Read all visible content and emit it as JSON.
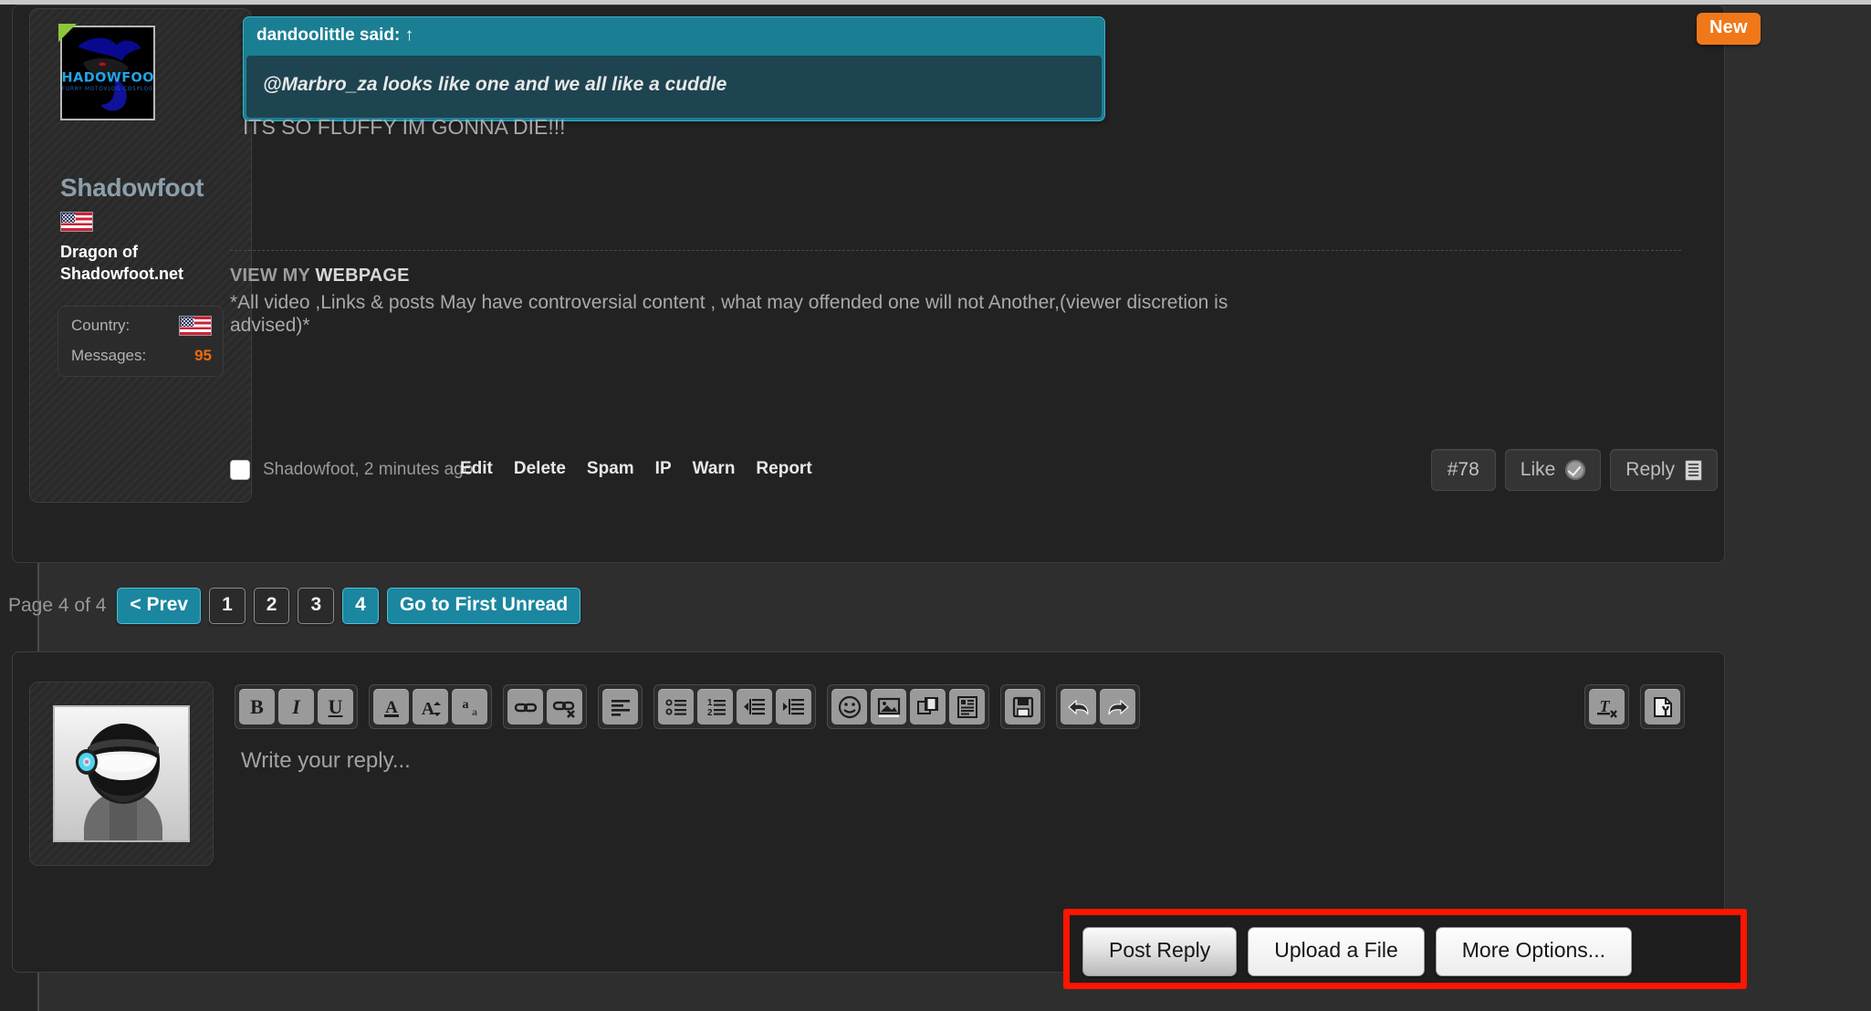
{
  "post": {
    "new_badge": "New",
    "member": {
      "name": "Shadowfoot",
      "title": "Dragon of Shadowfoot.net",
      "avatar_text": "SHADOWFOOT",
      "avatar_subtext": "FURRY MOTOVLOG COSPLOG",
      "stats": [
        {
          "label": "Country:",
          "value": "",
          "type": "flag"
        },
        {
          "label": "Messages:",
          "value": "95",
          "type": "number"
        }
      ],
      "country_flag": "us-flag-icon"
    },
    "quote": {
      "author_line": "dandoolittle said:",
      "jump_arrow": "↑",
      "text": "@Marbro_za looks like one and we all like a cuddle"
    },
    "body_text": "ITS SO FLUFFY IM GONNA DIE!!!",
    "signature": {
      "line1_prefix": "VIEW MY ",
      "line1_bold": "WEBPAGE",
      "line2": "*All video ,Links & posts May have controversial content , what may offended one will not Another,(viewer discretion is advised)*"
    },
    "footer": {
      "meta": "Shadowfoot, 2 minutes ago",
      "links": [
        "Edit",
        "Delete",
        "Spam",
        "IP",
        "Warn",
        "Report"
      ],
      "post_number": "#78",
      "like_label": "Like",
      "reply_label": "Reply"
    }
  },
  "pagination": {
    "label": "Page 4 of 4",
    "prev_label": "< Prev",
    "pages": [
      "1",
      "2",
      "3",
      "4"
    ],
    "current_page": "4",
    "first_unread_label": "Go to First Unread"
  },
  "reply_editor": {
    "placeholder": "Write your reply...",
    "toolbar_groups": [
      {
        "buttons": [
          {
            "name": "bold-icon",
            "label": "B"
          },
          {
            "name": "italic-icon",
            "label": "I"
          },
          {
            "name": "underline-icon",
            "label": "U"
          }
        ]
      },
      {
        "buttons": [
          {
            "name": "text-color-icon",
            "label": "A"
          },
          {
            "name": "font-size-icon",
            "label": "A"
          },
          {
            "name": "font-family-icon",
            "label": "a"
          }
        ]
      },
      {
        "buttons": [
          {
            "name": "insert-link-icon",
            "label": ""
          },
          {
            "name": "remove-link-icon",
            "label": ""
          }
        ]
      },
      {
        "buttons": [
          {
            "name": "text-align-icon",
            "label": ""
          }
        ]
      },
      {
        "buttons": [
          {
            "name": "bullet-list-icon",
            "label": ""
          },
          {
            "name": "numbered-list-icon",
            "label": ""
          },
          {
            "name": "outdent-icon",
            "label": ""
          },
          {
            "name": "indent-icon",
            "label": ""
          }
        ]
      },
      {
        "buttons": [
          {
            "name": "smilie-icon",
            "label": ""
          },
          {
            "name": "insert-image-icon",
            "label": ""
          },
          {
            "name": "insert-media-icon",
            "label": ""
          },
          {
            "name": "insert-quote-icon",
            "label": ""
          }
        ]
      },
      {
        "buttons": [
          {
            "name": "draft-save-icon",
            "label": ""
          }
        ]
      },
      {
        "buttons": [
          {
            "name": "undo-icon",
            "label": ""
          },
          {
            "name": "redo-icon",
            "label": ""
          }
        ]
      }
    ],
    "toolbar_right": [
      {
        "name": "remove-formatting-icon",
        "label": ""
      },
      {
        "name": "toggle-bbcode-icon",
        "label": ""
      }
    ]
  },
  "actions": {
    "post_reply_label": "Post Reply",
    "upload_file_label": "Upload a File",
    "more_options_label": "More Options...",
    "highlight_color": "#ff1500"
  },
  "colors": {
    "page_background": "#2e2e2e",
    "panel_background": "#222222",
    "quote_header": "#1b7f94",
    "quote_body": "#1d4450",
    "accent_teal": "#1b86a0",
    "badge_orange": "#f07818",
    "messages_count": "#f06a10"
  }
}
